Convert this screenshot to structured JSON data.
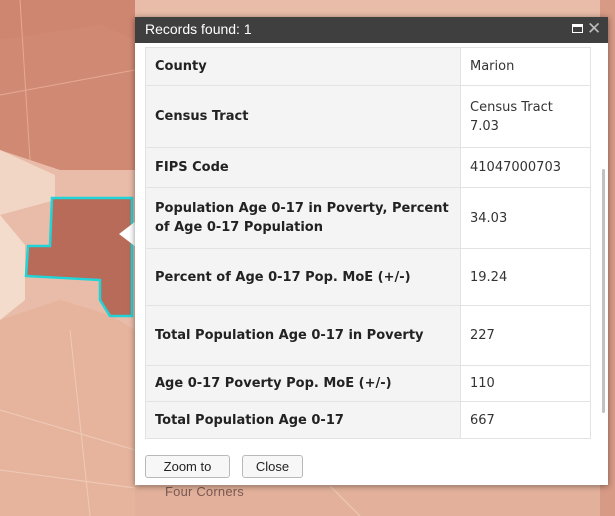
{
  "popup": {
    "title": "Records found: 1",
    "rows": [
      {
        "field": "County",
        "value": "Marion"
      },
      {
        "field": "Census Tract",
        "value": "Census Tract 7.03"
      },
      {
        "field": "FIPS Code",
        "value": "41047000703"
      },
      {
        "field": "Population Age 0-17 in Poverty, Percent of Age 0-17 Population",
        "value": "34.03"
      },
      {
        "field": "Percent of Age 0-17 Pop. MoE (+/-)",
        "value": "19.24"
      },
      {
        "field": "Total Population Age 0-17 in Poverty",
        "value": "227"
      },
      {
        "field": "Age 0-17 Poverty Pop. MoE (+/-)",
        "value": "110"
      },
      {
        "field": "Total Population Age 0-17",
        "value": "667"
      }
    ],
    "zoom_label": "Zoom to",
    "close_label": "Close",
    "maximize_icon": "maximize-icon",
    "close_icon": "close-icon"
  },
  "map": {
    "place_label": "Four Corners",
    "highlight_color": "#22d4d8",
    "selected_fill": "#b86b58"
  }
}
